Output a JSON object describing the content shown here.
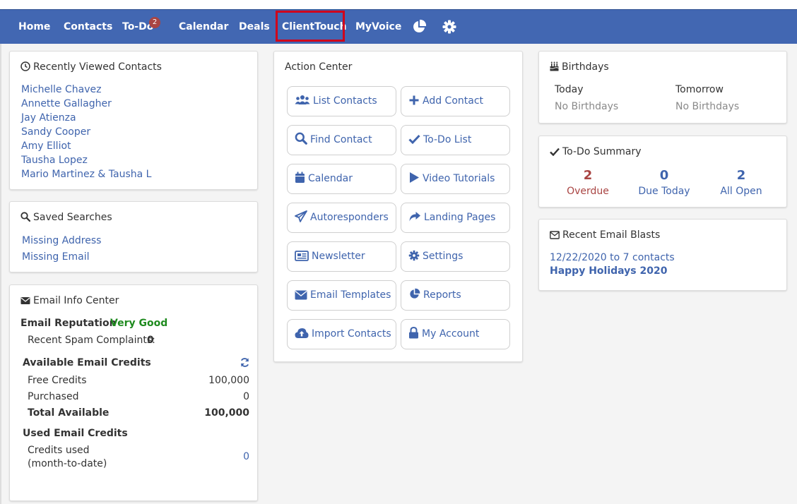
{
  "nav": {
    "items": [
      {
        "label": "Home"
      },
      {
        "label": "Contacts"
      },
      {
        "label": "To-Do",
        "badge": "2"
      },
      {
        "label": "Calendar"
      },
      {
        "label": "Deals"
      },
      {
        "label": "ClientTouch",
        "highlighted": true
      },
      {
        "label": "MyVoice"
      }
    ],
    "icons": [
      "pie-chart-icon",
      "gear-icon"
    ],
    "highlight_color": "#d0021b",
    "bar_color": "#4267b2"
  },
  "recent_contacts": {
    "title": "Recently Viewed Contacts",
    "items": [
      "Michelle Chavez",
      "Annette Gallagher",
      "Jay Atienza",
      "Sandy Cooper",
      "Amy Elliot",
      "Tausha Lopez",
      "Mario Martinez & Tausha L"
    ]
  },
  "saved_searches": {
    "title": "Saved Searches",
    "items": [
      "Missing Address",
      "Missing Email"
    ]
  },
  "email_info": {
    "title": "Email Info Center",
    "reputation_label": "Email Reputation",
    "reputation_value": "Very Good",
    "reputation_color": "#1e8a1e",
    "spam_label": "Recent Spam Complaints:",
    "spam_value": "0",
    "available_title": "Available Email Credits",
    "free_label": "Free Credits",
    "free_value": "100,000",
    "purchased_label": "Purchased",
    "purchased_value": "0",
    "total_label": "Total Available",
    "total_value": "100,000",
    "used_title": "Used Email Credits",
    "used_label_1": "Credits used",
    "used_label_2": "(month-to-date)",
    "used_value": "0"
  },
  "action_center": {
    "title": "Action Center",
    "buttons": [
      {
        "label": "List Contacts",
        "icon": "users-icon"
      },
      {
        "label": "Add Contact",
        "icon": "plus-icon"
      },
      {
        "label": "Find Contact",
        "icon": "search-icon"
      },
      {
        "label": "To-Do List",
        "icon": "check-icon"
      },
      {
        "label": "Calendar",
        "icon": "calendar-icon"
      },
      {
        "label": "Video Tutorials",
        "icon": "play-icon"
      },
      {
        "label": "Autoresponders",
        "icon": "paper-plane-icon"
      },
      {
        "label": "Landing Pages",
        "icon": "share-icon"
      },
      {
        "label": "Newsletter",
        "icon": "newspaper-icon"
      },
      {
        "label": "Settings",
        "icon": "gear-icon"
      },
      {
        "label": "Email Templates",
        "icon": "envelope-icon"
      },
      {
        "label": "Reports",
        "icon": "pie-chart-icon"
      },
      {
        "label": "Import Contacts",
        "icon": "cloud-upload-icon"
      },
      {
        "label": "My Account",
        "icon": "lock-icon"
      }
    ]
  },
  "birthdays": {
    "title": "Birthdays",
    "today_label": "Today",
    "today_value": "No Birthdays",
    "tomorrow_label": "Tomorrow",
    "tomorrow_value": "No Birthdays"
  },
  "todo_summary": {
    "title": "To-Do Summary",
    "overdue_count": "2",
    "overdue_label": "Overdue",
    "due_today_count": "0",
    "due_today_label": "Due Today",
    "all_open_count": "2",
    "all_open_label": "All Open",
    "overdue_color": "#a94442"
  },
  "email_blasts": {
    "title": "Recent Email Blasts",
    "date_line": "12/22/2020 to 7 contacts",
    "blast_name": "Happy Holidays 2020"
  }
}
